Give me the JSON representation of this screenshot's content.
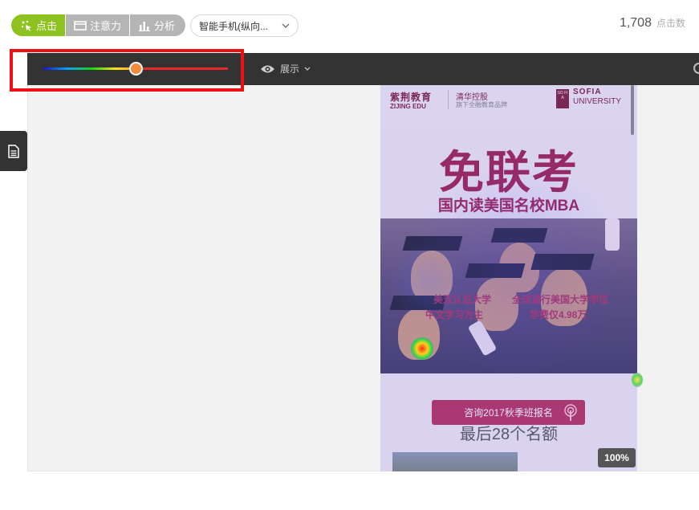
{
  "toolbar": {
    "modes": [
      {
        "label": "点击",
        "icon": "sparkle-click-icon",
        "active": true
      },
      {
        "label": "注意力",
        "icon": "window-icon",
        "active": false
      },
      {
        "label": "分析",
        "icon": "bar-chart-icon",
        "active": false
      }
    ],
    "device_select": {
      "value": "智能手机(纵向..."
    },
    "click_count": {
      "value": "1,708",
      "label": "点击数"
    }
  },
  "heatmap_bar": {
    "slider_value_fraction": 0.5,
    "display_label": "展示"
  },
  "preview": {
    "brand1": "紫荆教育",
    "brand1_sub": "ZIJING EDU",
    "brand2": "清华控股",
    "brand2_sub": "旗下全融教育品牌",
    "sofia_mark": "SO FI A",
    "brand3": "SOFIA",
    "brand3_sub": "UNIVERSITY",
    "hero_title": "免联考",
    "hero_subtitle": "国内读美国名校MBA",
    "caption_left_1": "美双认证大学",
    "caption_left_2": "中文学习为主",
    "caption_right_1": "全球通行美国大学学位",
    "caption_right_2": "学费仅4.98万",
    "cta_label": "咨询2017秋季班报名",
    "seats_text": "最后28个名额"
  },
  "zoom": "100%",
  "colors": {
    "accent": "#8ec31f",
    "highlight": "#ee1111",
    "brand": "#9c1f4f"
  }
}
